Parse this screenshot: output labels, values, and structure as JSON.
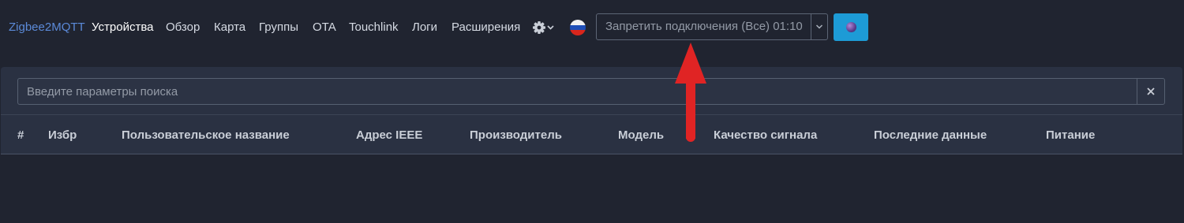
{
  "navbar": {
    "brand": "Zigbee2MQTT",
    "links": [
      {
        "label": "Устройства",
        "active": true
      },
      {
        "label": "Обзор"
      },
      {
        "label": "Карта"
      },
      {
        "label": "Группы"
      },
      {
        "label": "OTA"
      },
      {
        "label": "Touchlink"
      },
      {
        "label": "Логи"
      },
      {
        "label": "Расширения"
      }
    ],
    "settings_icon": "gear-icon",
    "language_flag": "russian-flag-icon",
    "permit_join": {
      "label": "Запретить подключения (Все) 01:10",
      "toggle_icon": "chevron-down-icon"
    },
    "status_button": {
      "icon": "status-dot-icon",
      "color": "#1d9bd6"
    }
  },
  "search": {
    "placeholder": "Введите параметры поиска",
    "value": "",
    "clear_icon": "close-icon"
  },
  "table": {
    "headers": [
      "#",
      "Избр",
      "Пользовательское название",
      "Адрес IEEE",
      "Производитель",
      "Модель",
      "Качество сигнала",
      "Последние данные",
      "Питание"
    ],
    "rows": []
  },
  "colors": {
    "background": "#202430",
    "panel": "#2a3142",
    "brand": "#5b8ad8",
    "accent": "#1d9bd6",
    "annotation": "#e02424"
  }
}
